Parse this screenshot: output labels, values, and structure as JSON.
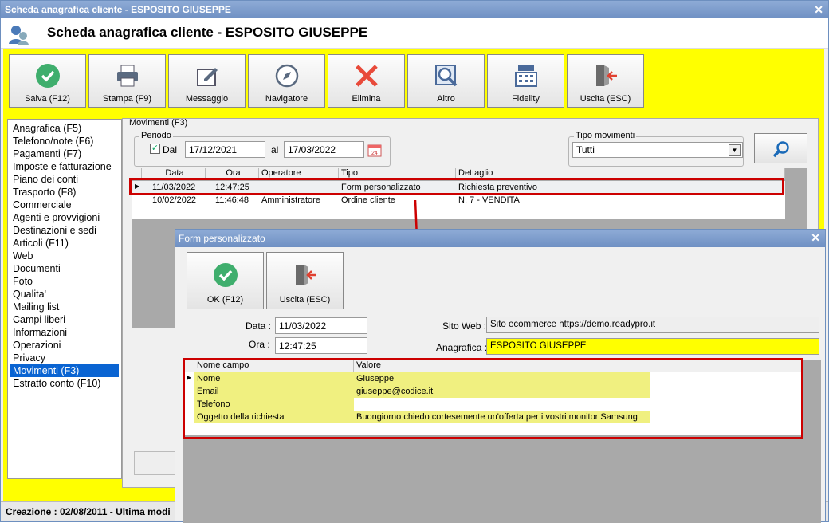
{
  "window": {
    "title": "Scheda anagrafica cliente - ESPOSITO GIUSEPPE",
    "header_title": "Scheda anagrafica cliente - ESPOSITO GIUSEPPE"
  },
  "toolbar": [
    {
      "label": "Salva (F12)",
      "icon": "check-icon"
    },
    {
      "label": "Stampa (F9)",
      "icon": "printer-icon"
    },
    {
      "label": "Messaggio",
      "icon": "message-icon"
    },
    {
      "label": "Navigatore",
      "icon": "compass-icon"
    },
    {
      "label": "Elimina",
      "icon": "delete-icon"
    },
    {
      "label": "Altro",
      "icon": "magnifier-icon"
    },
    {
      "label": "Fidelity",
      "icon": "cash-register-icon"
    },
    {
      "label": "Uscita (ESC)",
      "icon": "exit-icon"
    }
  ],
  "sidebar": {
    "items": [
      "Anagrafica (F5)",
      "Telefono/note (F6)",
      "Pagamenti (F7)",
      "Imposte e fatturazione",
      "Piano dei conti",
      "Trasporto (F8)",
      "Commerciale",
      "Agenti e provvigioni",
      "Destinazioni e sedi",
      "Articoli (F11)",
      "Web",
      "Documenti",
      "Foto",
      "Qualita'",
      "Mailing list",
      "Campi liberi",
      "Informazioni",
      "Operazioni",
      "Privacy",
      "Movimenti (F3)",
      "Estratto conto (F10)"
    ],
    "selected": "Movimenti (F3)"
  },
  "movimenti": {
    "caption": "Movimenti (F3)",
    "periodo_label": "Periodo",
    "dal_label": "Dal",
    "dal_checked": true,
    "dal_value": "17/12/2021",
    "al_label": "al",
    "al_value": "17/03/2022",
    "tipo_label": "Tipo movimenti",
    "tipo_value": "Tutti",
    "columns": [
      "Data",
      "Ora",
      "Operatore",
      "Tipo",
      "Dettaglio"
    ],
    "rows": [
      [
        "11/03/2022",
        "12:47:25",
        "",
        "Form personalizzato",
        "Richiesta preventivo"
      ],
      [
        "10/02/2022",
        "11:46:48",
        "Amministratore",
        "Ordine cliente",
        "N. 7 - VENDITA"
      ]
    ]
  },
  "status": {
    "text": "Creazione : 02/08/2011 - Ultima modi"
  },
  "dialog": {
    "title": "Form personalizzato",
    "ok_label": "OK (F12)",
    "exit_label": "Uscita (ESC)",
    "data_label": "Data :",
    "data_value": "11/03/2022",
    "ora_label": "Ora :",
    "ora_value": "12:47:25",
    "sito_label": "Sito Web :",
    "sito_value": "Sito ecommerce https://demo.readypro.it",
    "anagrafica_label": "Anagrafica :",
    "anagrafica_value": "ESPOSITO GIUSEPPE",
    "columns": [
      "Nome campo",
      "Valore"
    ],
    "rows": [
      [
        "Nome",
        "Giuseppe"
      ],
      [
        "Email",
        "giuseppe@codice.it"
      ],
      [
        "Telefono",
        ""
      ],
      [
        "Oggetto della richiesta",
        "Buongiorno chiedo cortesemente un'offerta per i vostri monitor Samsung"
      ]
    ]
  },
  "colors": {
    "highlight": "#ffff00",
    "row_highlight": "#f0f080",
    "selection": "#0a64d2",
    "annotation": "#cc0000"
  }
}
